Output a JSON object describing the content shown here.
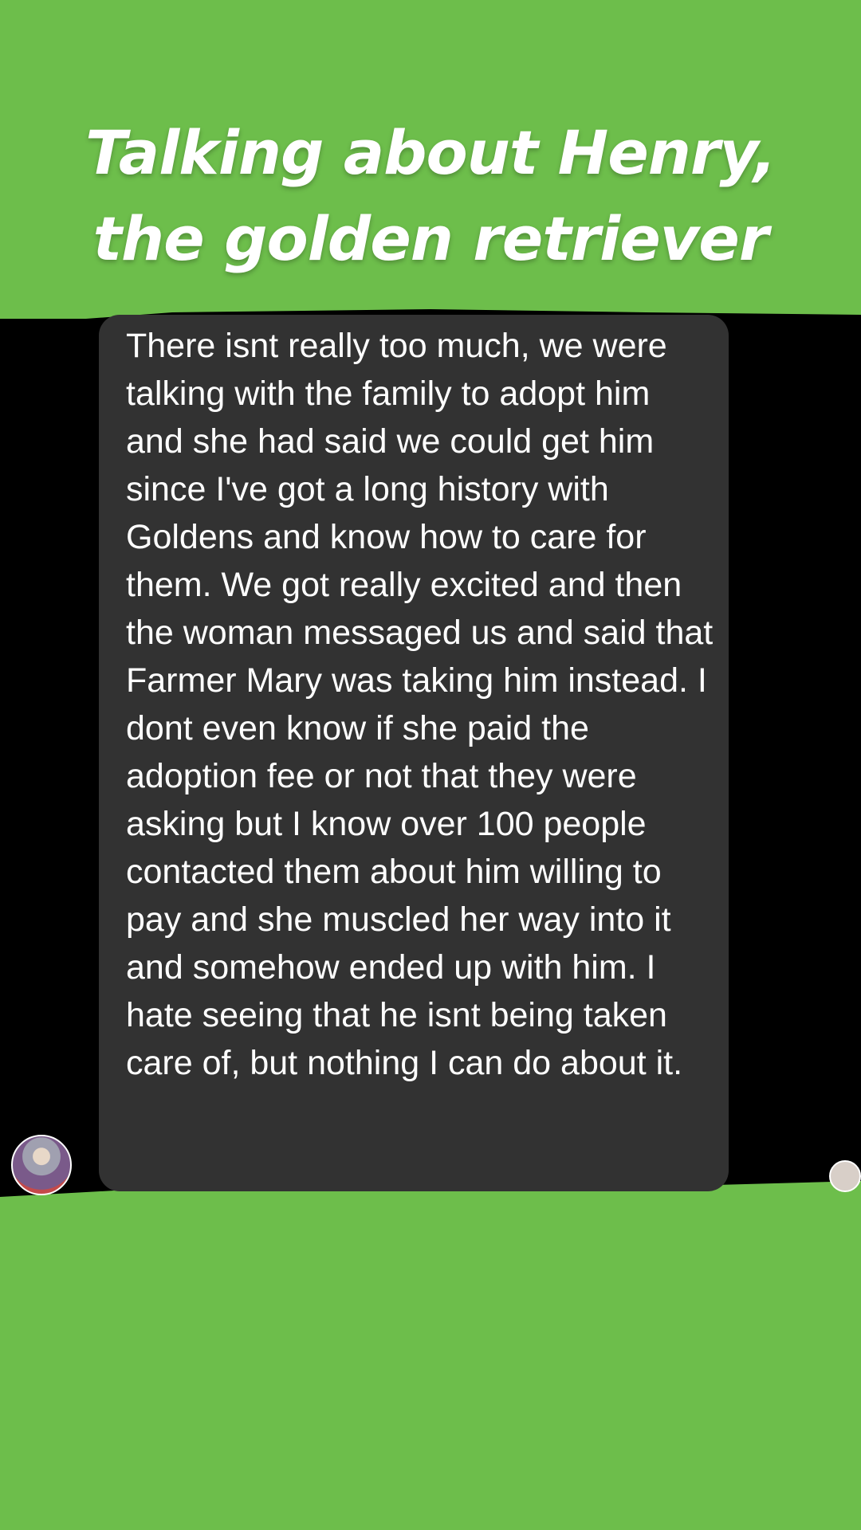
{
  "story": {
    "headline_line1": "Talking about Henry,",
    "headline_line2": "the golden retriever",
    "accent_color": "#6dbe4b"
  },
  "message": {
    "text": "There isnt really too much, we were talking with the family to adopt him and she had said we could get him since I've got a long history with Goldens and know how to care for them. We got really excited and then the woman messaged us and said that Farmer Mary was taking him instead. I dont even know if she paid the adoption fee or not that they were asking but I know over 100 people contacted them about him willing to pay and she muscled her way into it and somehow ended up with him. I hate seeing that he isnt being taken care of, but nothing I can do about it.",
    "bubble_color": "#323232"
  },
  "avatars": {
    "sender_icon": "profile-photo-icon",
    "read_receipt_icon": "profile-photo-icon"
  }
}
